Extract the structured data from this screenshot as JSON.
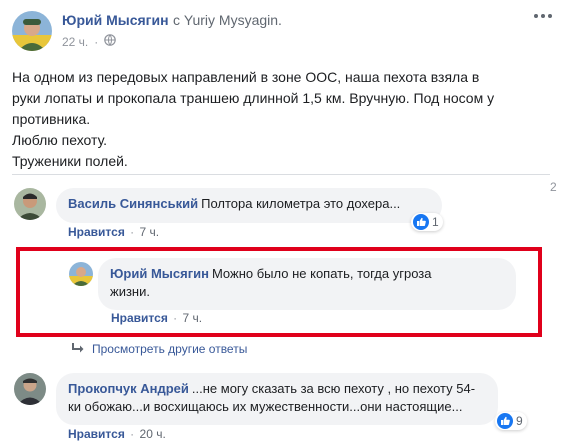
{
  "post": {
    "author": "Юрий Мысягин",
    "via": "с Yuriy Mysyagin.",
    "time": "22 ч.",
    "text_lines": [
      "На одном из передовых направлений в зоне ООС, наша пехота взяла в",
      "руки лопаты и прокопала траншею длинной 1,5 км. Вручную. Под носом у",
      "противника.",
      "Люблю пехоту.",
      "Труженики полей."
    ],
    "more_icon": "ellipsis-icon",
    "audience_icon": "globe-icon"
  },
  "comments": [
    {
      "author": "Василь Синянський",
      "text": "Полтора километра это дохера...",
      "like_label": "Нравится",
      "time": "7 ч.",
      "reactions": "1",
      "reaction_icon": "like-icon"
    },
    {
      "author": "Юрий Мысягин",
      "text_line1": "Можно было не копать, тогда угроза",
      "text_line2": "жизни.",
      "like_label": "Нравится",
      "time": "7 ч."
    },
    {
      "author": "Прокопчук Андрей",
      "text_line1": "...не могу сказать за всю пехоту , но пехоту 54-",
      "text_line2": "ки обожаю...и восхищаюсь их мужественности...они настоящие...",
      "like_label": "Нравится",
      "time": "20 ч.",
      "reactions": "9",
      "reaction_icon": "like-icon"
    }
  ],
  "replies": {
    "view_more": "Просмотреть другие ответы",
    "icon": "reply-arrow-icon"
  },
  "side_marker": "2",
  "colors": {
    "link": "#385898",
    "highlight": "#e0001b",
    "bubble": "#f2f3f5",
    "like": "#1877f2"
  }
}
